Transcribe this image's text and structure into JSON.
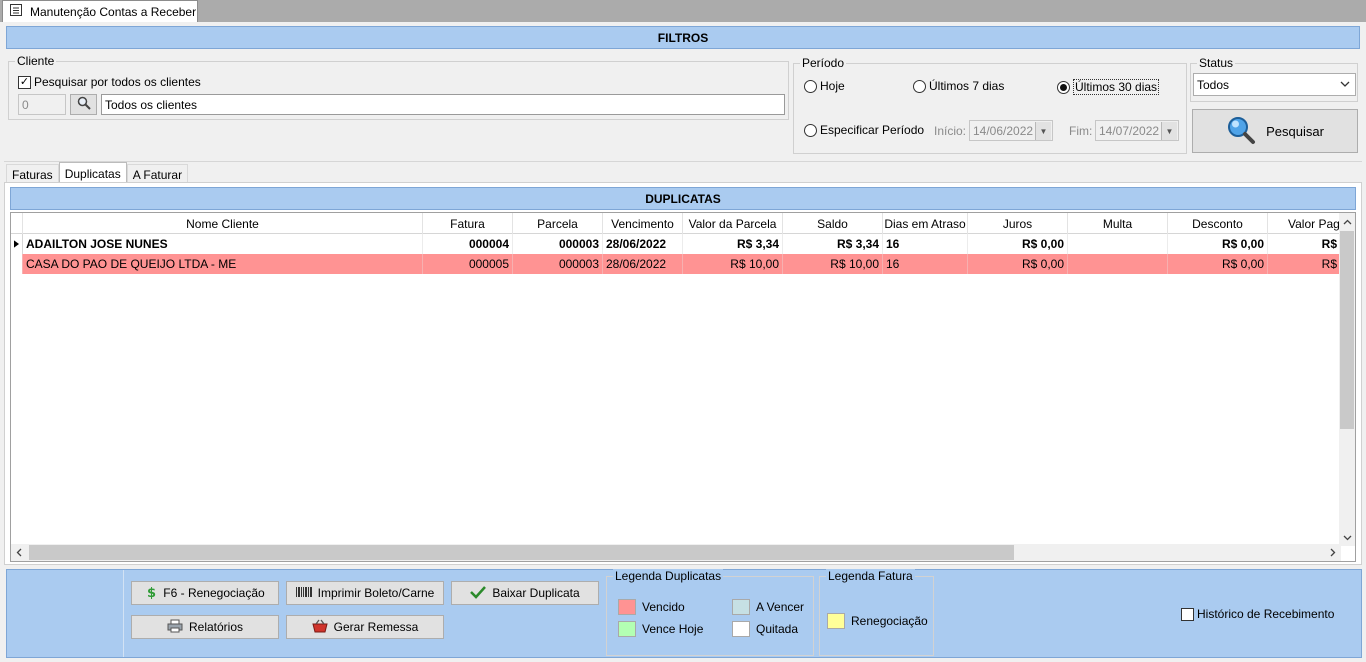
{
  "window": {
    "tab_title": "Manutenção Contas a Receber"
  },
  "filters": {
    "band_title": "FILTROS",
    "client": {
      "legend": "Cliente",
      "all_clients_label": "Pesquisar por todos os clientes",
      "all_clients_checked": true,
      "code_value": "0",
      "name_value": "Todos os clientes"
    },
    "period": {
      "legend": "Período",
      "options": [
        {
          "label": "Hoje",
          "selected": false
        },
        {
          "label": "Últimos 7 dias",
          "selected": false
        },
        {
          "label": "Últimos 30 dias",
          "selected": true
        }
      ],
      "custom_label": "Especificar Período",
      "start_label": "Início:",
      "start_value": "14/06/2022",
      "end_label": "Fim:",
      "end_value": "14/07/2022"
    },
    "status": {
      "legend": "Status",
      "selected": "Todos"
    },
    "search_button": "Pesquisar"
  },
  "tabs": [
    {
      "label": "Faturas",
      "active": false
    },
    {
      "label": "Duplicatas",
      "active": true
    },
    {
      "label": "A Faturar",
      "active": false
    }
  ],
  "grid": {
    "band_title": "DUPLICATAS",
    "columns": [
      "Nome Cliente",
      "Fatura",
      "Parcela",
      "Vencimento",
      "Valor da Parcela",
      "Saldo",
      "Dias em Atraso",
      "Juros",
      "Multa",
      "Desconto",
      "Valor Pag"
    ],
    "rows": [
      {
        "cliente": "ADAILTON JOSE NUNES",
        "fatura": "000004",
        "parcela": "000003",
        "vencimento": "28/06/2022",
        "valor_parcela": "R$ 3,34",
        "saldo": "R$ 3,34",
        "dias_atraso": "16",
        "juros": "R$ 0,00",
        "multa": "",
        "desconto": "R$ 0,00",
        "valor_pago": "R$",
        "current": true,
        "status": "selected"
      },
      {
        "cliente": "CASA DO PAO DE QUEIJO LTDA - ME",
        "fatura": "000005",
        "parcela": "000003",
        "vencimento": "28/06/2022",
        "valor_parcela": "R$ 10,00",
        "saldo": "R$ 10,00",
        "dias_atraso": "16",
        "juros": "R$ 0,00",
        "multa": "",
        "desconto": "R$ 0,00",
        "valor_pago": "R$",
        "current": false,
        "status": "vencido"
      }
    ]
  },
  "actions": {
    "renegociacao": "F6 - Renegociação",
    "imprimir": "Imprimir Boleto/Carne",
    "baixar": "Baixar Duplicata",
    "relatorios": "Relatórios",
    "remessa": "Gerar Remessa"
  },
  "legend_duplicatas": {
    "title": "Legenda Duplicatas",
    "items": [
      {
        "label": "Vencido",
        "color": "#ff9393"
      },
      {
        "label": "A Vencer",
        "color": "#c6e0e4"
      },
      {
        "label": "Vence Hoje",
        "color": "#b3ffb3"
      },
      {
        "label": "Quitada",
        "color": "#ffffff"
      }
    ]
  },
  "legend_fatura": {
    "title": "Legenda Fatura",
    "items": [
      {
        "label": "Renegociação",
        "color": "#ffff99"
      }
    ]
  },
  "historico": {
    "label": "Histórico de Recebimento",
    "checked": false
  }
}
